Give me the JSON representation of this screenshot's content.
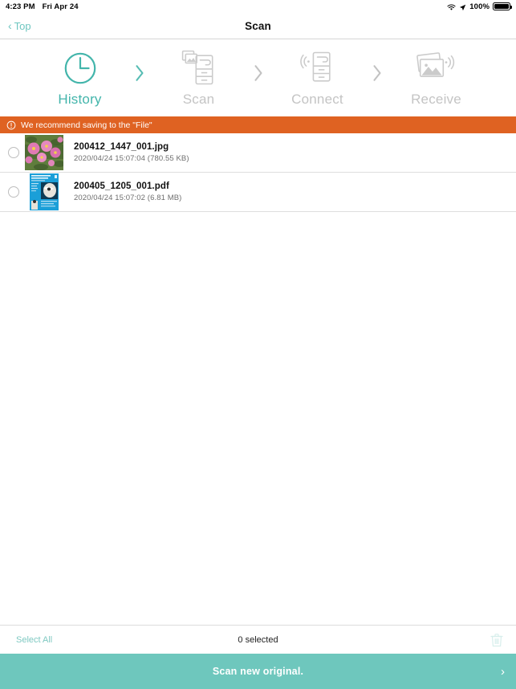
{
  "status_bar": {
    "time": "4:23 PM",
    "date": "Fri Apr 24",
    "battery_percent": "100%",
    "wifi_icon": "wifi-icon",
    "location_icon": "location-arrow-icon",
    "battery_icon": "battery-full-icon"
  },
  "nav": {
    "back_label": "Top",
    "back_chevron": "‹",
    "title": "Scan"
  },
  "steps": [
    {
      "label": "History",
      "icon": "clock-icon",
      "active": true
    },
    {
      "label": "Scan",
      "icon": "scanner-with-photos-icon",
      "active": false
    },
    {
      "label": "Connect",
      "icon": "scanner-wireless-icon",
      "active": false
    },
    {
      "label": "Receive",
      "icon": "photos-wireless-icon",
      "active": false
    }
  ],
  "step_arrows": [
    "›",
    "›",
    "›"
  ],
  "banner": {
    "icon": "info-circle-icon",
    "text": "We recommend saving to the \"File\"",
    "background_color": "#df6222"
  },
  "file_list": [
    {
      "checkbox": "unchecked",
      "thumbnail": "pink-flowers-photo-thumbnail",
      "name": "200412_1447_001.jpg",
      "meta": "2020/04/24 15:07:04 (780.55 KB)"
    },
    {
      "checkbox": "unchecked",
      "thumbnail": "blue-document-pdf-thumbnail",
      "name": "200405_1205_001.pdf",
      "meta": "2020/04/24 15:07:02 (6.81 MB)"
    }
  ],
  "toolbar": {
    "select_all_label": "Select All",
    "selected_count_label": "0 selected",
    "trash_icon": "trash-icon"
  },
  "cta": {
    "label": "Scan new original.",
    "chevron": "›",
    "background_color": "#6ec7bd"
  },
  "colors": {
    "accent_teal": "#6ec7bd",
    "active_teal": "#43b5ab",
    "banner_orange": "#df6222",
    "inactive_gray": "#c4c4c4"
  }
}
